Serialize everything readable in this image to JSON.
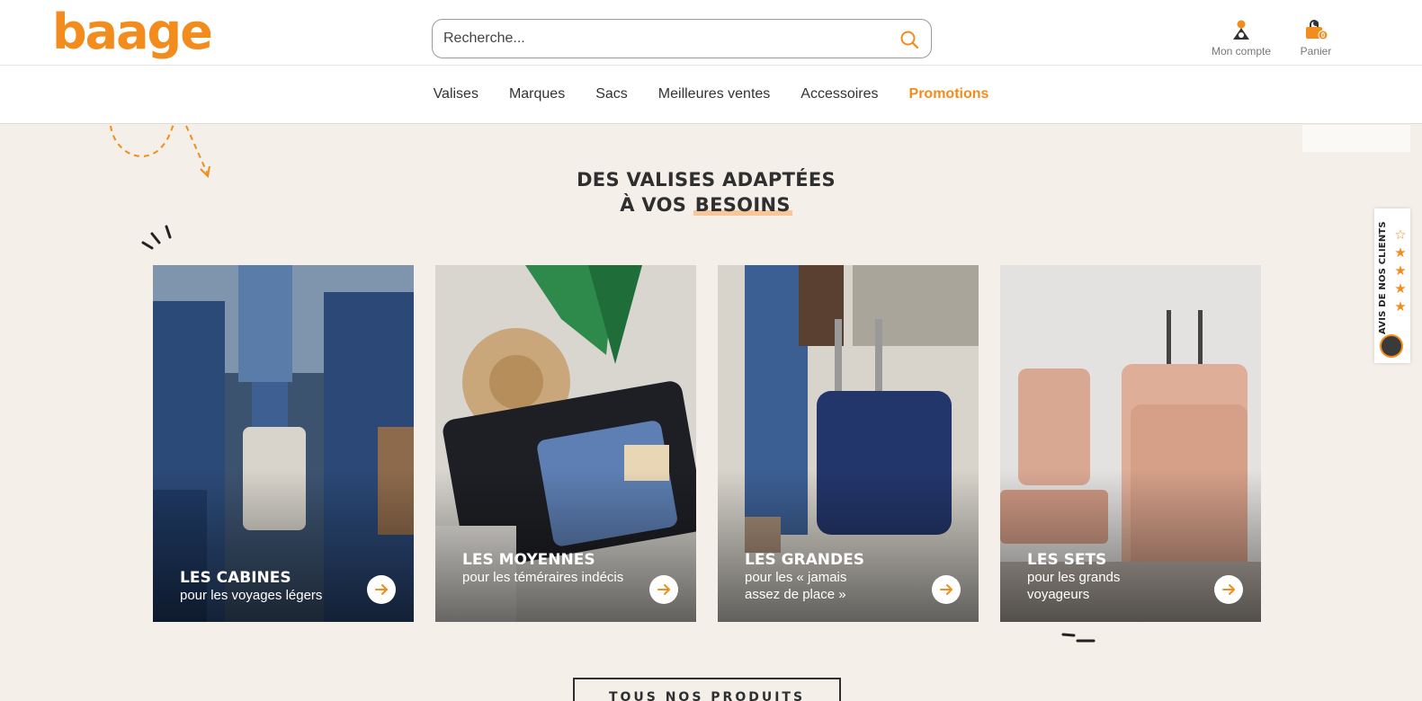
{
  "header": {
    "logo": "baage",
    "search_placeholder": "Recherche...",
    "account_label": "Mon compte",
    "cart_label": "Panier",
    "cart_count": "0"
  },
  "nav": {
    "items": [
      "Valises",
      "Marques",
      "Sacs",
      "Meilleures ventes",
      "Accessoires",
      "Promotions"
    ]
  },
  "section": {
    "title_line1": "DES VALISES ADAPTÉES",
    "title_line2_prefix": "À VOS ",
    "title_highlight": "BESOINS"
  },
  "cards": [
    {
      "title": "LES CABINES",
      "subtitle": "pour les voyages légers"
    },
    {
      "title": "LES MOYENNES",
      "subtitle": "pour les téméraires indécis"
    },
    {
      "title": "LES GRANDES",
      "subtitle": "pour les « jamais assez de place »"
    },
    {
      "title": "LES SETS",
      "subtitle": "pour les grands voyageurs"
    }
  ],
  "cta_label": "TOUS NOS PRODUITS",
  "reviews_widget": {
    "label": "AVIS DE NOS CLIENTS"
  },
  "colors": {
    "accent": "#f28c1c",
    "background": "#f4efe9",
    "text": "#2f2f2f"
  },
  "icons": [
    "search-icon",
    "user-icon",
    "cart-icon",
    "arrow-right-icon",
    "star-icon"
  ]
}
